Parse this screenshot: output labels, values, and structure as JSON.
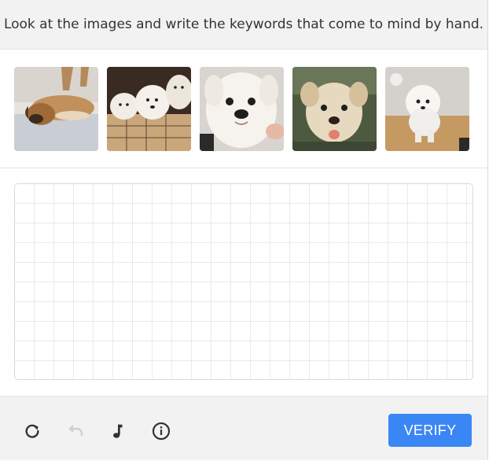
{
  "header": {
    "prompt": "Look at the images and write the keywords that come to mind by hand."
  },
  "images": [
    {
      "name": "puppy-sleeping-image",
      "subject": "puppy lying on floor"
    },
    {
      "name": "puppies-in-box-image",
      "subject": "three white puppies in box"
    },
    {
      "name": "white-puppy-closeup-image",
      "subject": "white puppy face"
    },
    {
      "name": "puppy-on-grass-image",
      "subject": "cream puppy outdoors"
    },
    {
      "name": "fluffy-puppy-image",
      "subject": "fluffy white puppy standing"
    }
  ],
  "canvas": {
    "name": "handwriting-canvas"
  },
  "footer": {
    "icons": [
      "refresh-icon",
      "undo-icon",
      "audio-icon",
      "info-icon"
    ],
    "verify_label": "VERIFY"
  },
  "colors": {
    "accent": "#3b86f5",
    "header_bg": "#f2f2f2",
    "grid": "#eaeaea"
  }
}
